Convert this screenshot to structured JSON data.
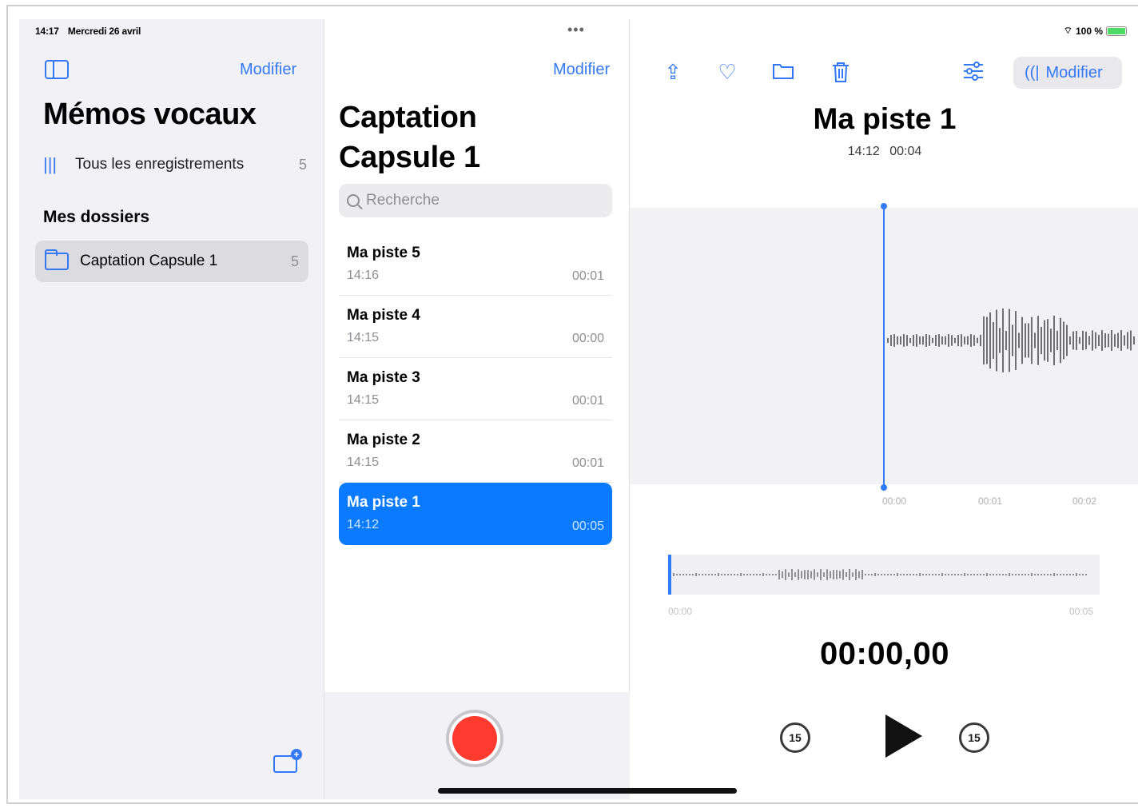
{
  "status_bar": {
    "time": "14:17",
    "date": "Mercredi 26 avril",
    "more": "•••",
    "battery": "100 %"
  },
  "sidebar": {
    "edit_label": "Modifier",
    "title": "Mémos vocaux",
    "all_recordings": {
      "label": "Tous les enregistrements",
      "count": "5"
    },
    "section_title": "Mes dossiers",
    "folders": [
      {
        "label": "Captation Capsule 1",
        "count": "5"
      }
    ]
  },
  "list": {
    "edit_label": "Modifier",
    "title_line1": "Captation",
    "title_line2": "Capsule 1",
    "search_placeholder": "Recherche",
    "items": [
      {
        "name": "Ma piste 5",
        "time": "14:16",
        "duration": "00:01"
      },
      {
        "name": "Ma piste 4",
        "time": "14:15",
        "duration": "00:00"
      },
      {
        "name": "Ma piste 3",
        "time": "14:15",
        "duration": "00:01"
      },
      {
        "name": "Ma piste 2",
        "time": "14:15",
        "duration": "00:01"
      },
      {
        "name": "Ma piste 1",
        "time": "14:12",
        "duration": "00:05",
        "selected": true
      }
    ]
  },
  "detail": {
    "edit_label": "Modifier",
    "title": "Ma piste 1",
    "time": "14:12",
    "duration": "00:04",
    "wave_ticks": [
      "00:00",
      "00:01",
      "00:02"
    ],
    "overview_ticks": [
      "00:00",
      "00:05"
    ],
    "timer": "00:00,00",
    "skip_back": "15",
    "skip_forward": "15"
  },
  "colors": {
    "accent": "#3478f6",
    "selected_row": "#0a7aff",
    "record": "#ff3b30"
  },
  "icons": [
    "sidebar-toggle-icon",
    "waveform-icon",
    "folder-icon",
    "new-folder-icon",
    "search-icon",
    "share-icon",
    "heart-icon",
    "folder-move-icon",
    "trash-icon",
    "settings-sliders-icon",
    "skip-back-15-icon",
    "play-icon",
    "skip-forward-15-icon",
    "record-icon"
  ]
}
